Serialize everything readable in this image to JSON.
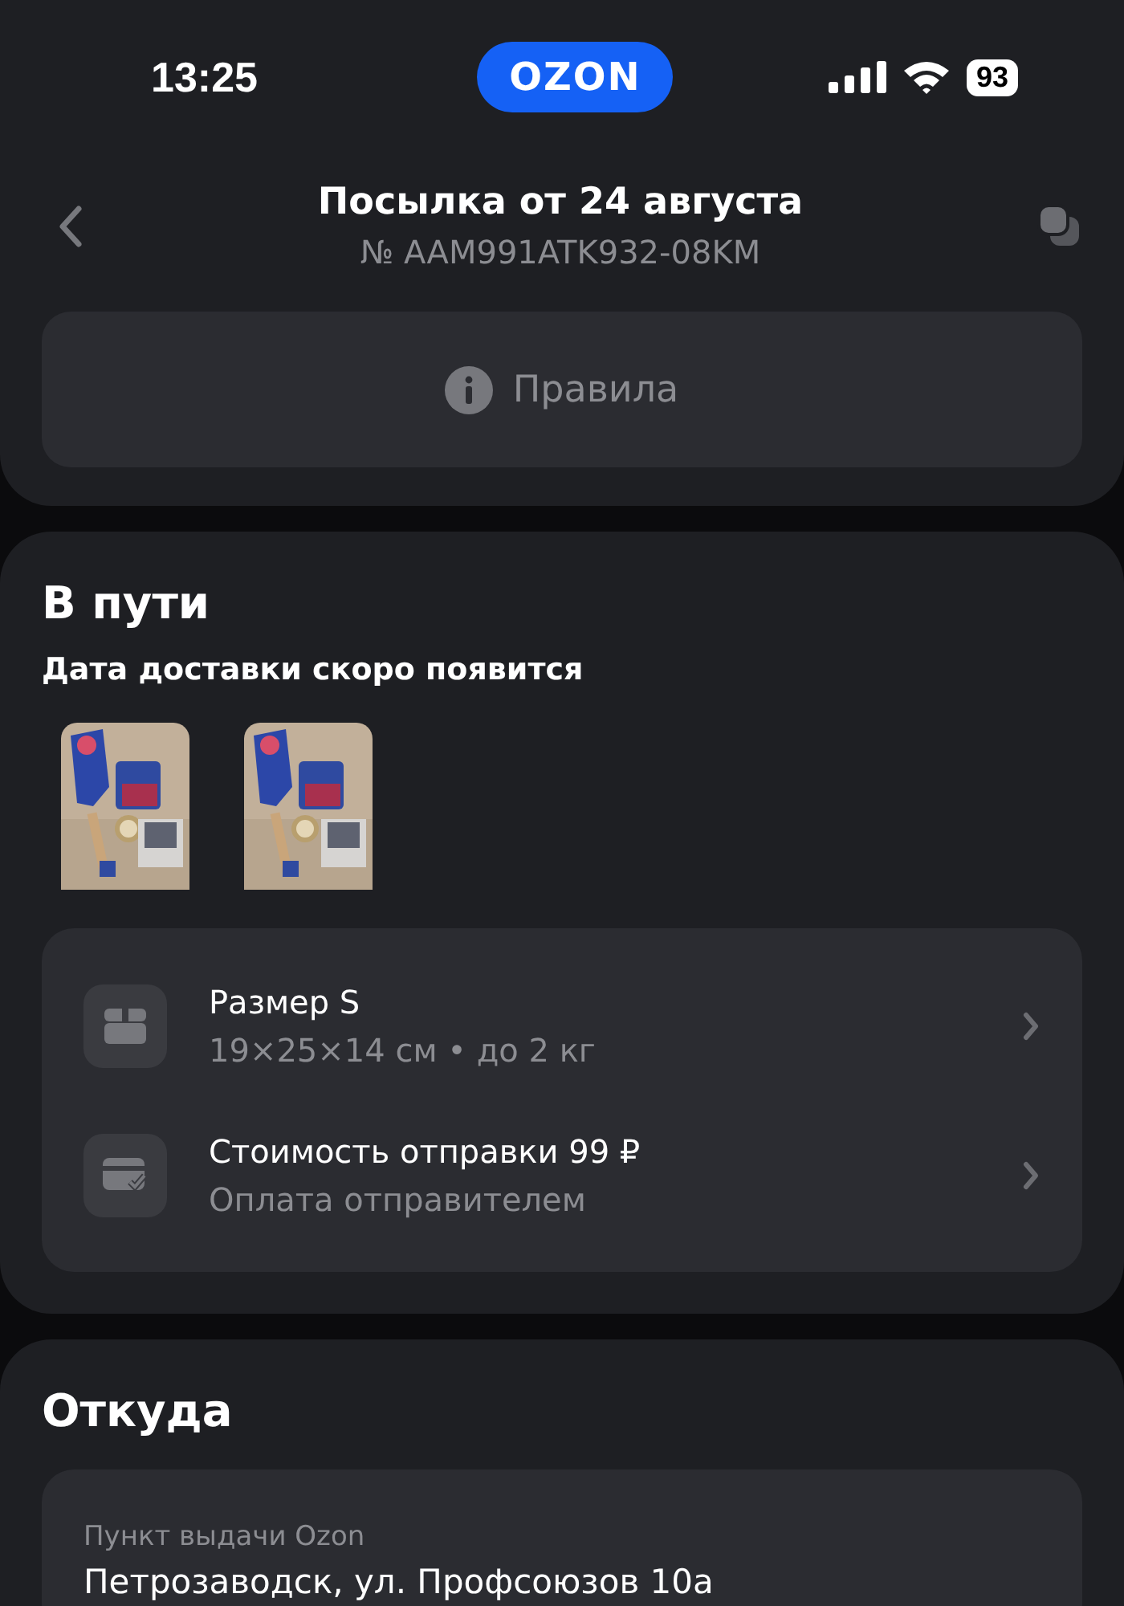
{
  "status_bar": {
    "time": "13:25",
    "logo": "OZON",
    "battery": "93"
  },
  "header": {
    "title": "Посылка от 24 августа",
    "number": "№ AAM991ATK932-08KM"
  },
  "rules_button": {
    "label": "Правила"
  },
  "status": {
    "title": "В пути",
    "subtitle": "Дата доставки скоро появится",
    "details": [
      {
        "kind": "box",
        "title": "Размер S",
        "subtitle": "19×25×14 см • до 2 кг"
      },
      {
        "kind": "payment",
        "title": "Стоимость отправки 99 ₽",
        "subtitle": "Оплата отправителем"
      }
    ]
  },
  "origin": {
    "title": "Откуда",
    "label": "Пункт выдачи Ozon",
    "address": "Петрозаводск, ул. Профсоюзов 10а"
  }
}
